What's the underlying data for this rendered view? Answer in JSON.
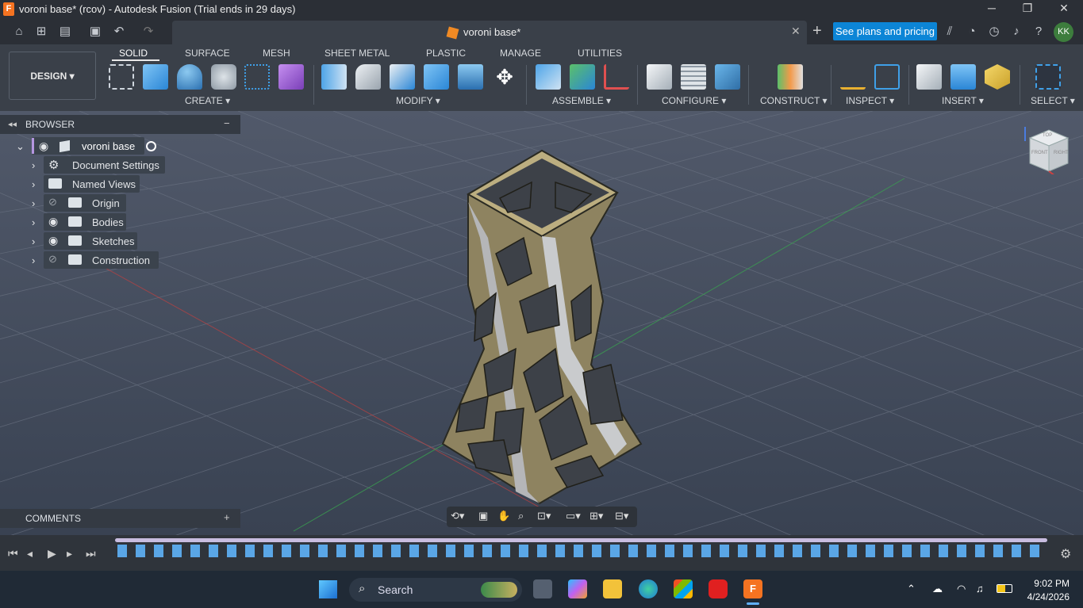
{
  "window": {
    "title": "voroni base* (rcov) - Autodesk Fusion (Trial ends in 29 days)",
    "app_icon": "F",
    "min": "─",
    "restore": "❐",
    "close": "✕"
  },
  "doc_tab": {
    "name": "voroni base*",
    "close": "✕"
  },
  "plans_button": "See plans and pricing",
  "user_initials": "KK",
  "design_label": "DESIGN",
  "tabs": [
    "SOLID",
    "SURFACE",
    "MESH",
    "SHEET METAL",
    "PLASTIC",
    "MANAGE",
    "UTILITIES"
  ],
  "groups": [
    "CREATE",
    "MODIFY",
    "ASSEMBLE",
    "CONFIGURE",
    "CONSTRUCT",
    "INSPECT",
    "INSERT",
    "SELECT"
  ],
  "browser": {
    "header": "BROWSER",
    "root": "voroni base",
    "items": [
      "Document Settings",
      "Named Views",
      "Origin",
      "Bodies",
      "Sketches",
      "Construction"
    ]
  },
  "comments": "COMMENTS",
  "viewcube": {
    "top": "TOP",
    "front": "FRONT",
    "right": "RIGHT"
  },
  "taskbar": {
    "search": "Search",
    "time": "9:02 PM",
    "date": "4/24/2026"
  },
  "colors": {
    "accent": "#0c85d6",
    "model": "#8e8360",
    "background": "#3b4454"
  }
}
